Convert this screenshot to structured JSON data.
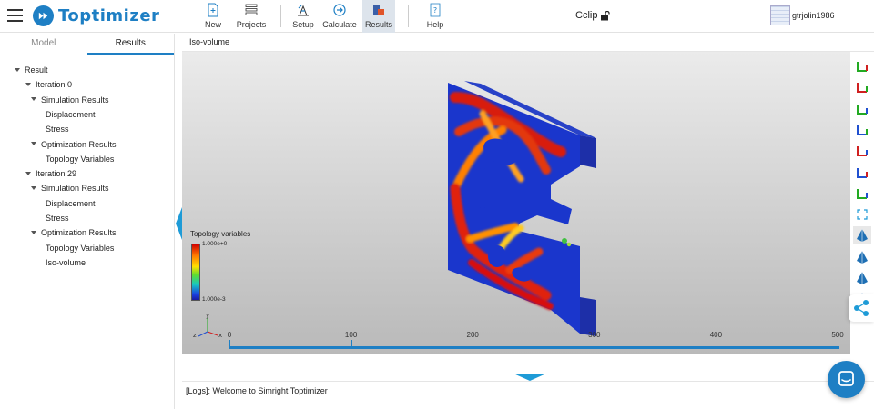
{
  "app": {
    "name": "Toptimizer"
  },
  "toolbar": {
    "new": {
      "label": "New",
      "icon": "new-document-icon"
    },
    "projects": {
      "label": "Projects",
      "icon": "list-icon"
    },
    "setup": {
      "label": "Setup",
      "icon": "setup-icon"
    },
    "calculate": {
      "label": "Calculate",
      "icon": "calculate-icon"
    },
    "results": {
      "label": "Results",
      "icon": "results-icon",
      "active": true
    },
    "help": {
      "label": "Help",
      "icon": "help-icon"
    }
  },
  "document": {
    "title": "Cclip",
    "lock_icon": "lock-open-icon"
  },
  "user": {
    "name": "gtrjolin1986"
  },
  "left_panel": {
    "tabs": [
      {
        "label": "Model",
        "active": false
      },
      {
        "label": "Results",
        "active": true
      }
    ],
    "tree": [
      {
        "label": "Result",
        "level": 0,
        "expanded": true
      },
      {
        "label": "Iteration 0",
        "level": 1,
        "expanded": true
      },
      {
        "label": "Simulation Results",
        "level": 2,
        "expanded": true
      },
      {
        "label": "Displacement",
        "level": 3
      },
      {
        "label": "Stress",
        "level": 3
      },
      {
        "label": "Optimization Results",
        "level": 2,
        "expanded": true
      },
      {
        "label": "Topology Variables",
        "level": 3
      },
      {
        "label": "Iteration 29",
        "level": 1,
        "expanded": true
      },
      {
        "label": "Simulation Results",
        "level": 2,
        "expanded": true
      },
      {
        "label": "Displacement",
        "level": 3
      },
      {
        "label": "Stress",
        "level": 3
      },
      {
        "label": "Optimization Results",
        "level": 2,
        "expanded": true
      },
      {
        "label": "Topology Variables",
        "level": 3
      },
      {
        "label": "Iso-volume",
        "level": 3
      }
    ]
  },
  "viewport": {
    "title": "Iso-volume",
    "legend": {
      "title": "Topology variables",
      "max": "1.000e+0",
      "min": "1.000e-3"
    },
    "triad": {
      "y": "y",
      "z": "z",
      "x": "x"
    },
    "timeline": {
      "ticks": [
        "0",
        "100",
        "200",
        "300",
        "400",
        "500"
      ]
    },
    "colors": {
      "accent": "#1e7fc4",
      "high": "#d00000",
      "low": "#1a2fc8"
    }
  },
  "view_toolbar": {
    "buttons": [
      "view-top-icon",
      "view-bottom-icon",
      "view-left-icon",
      "view-right-icon",
      "view-front-icon",
      "view-back-icon",
      "view-iso-icon",
      "fit-view-icon",
      "shaded-mode-icon",
      "wireframe-mode-icon",
      "edges-mode-icon",
      "points-mode-icon"
    ]
  },
  "logs": {
    "message": "[Logs]: Welcome to Simright Toptimizer"
  }
}
